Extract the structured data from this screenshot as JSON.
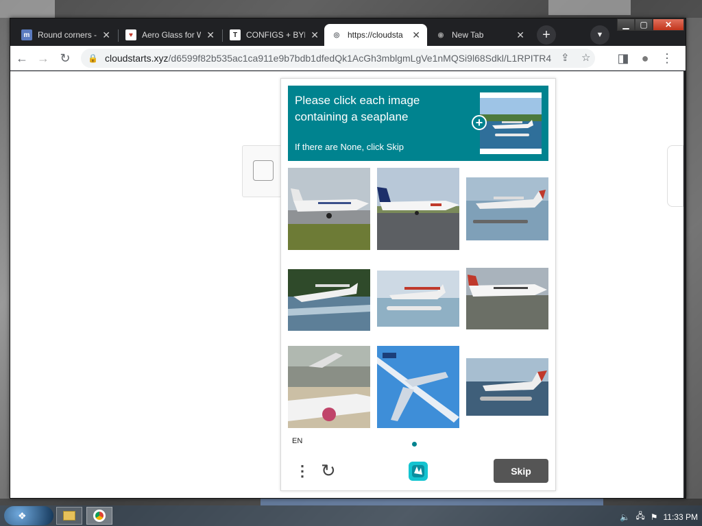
{
  "tabs": [
    {
      "title": "Round corners - ",
      "favicon_text": "m",
      "favicon_color": "#5b7bbf",
      "active": false
    },
    {
      "title": "Aero Glass for W",
      "favicon_text": "♥",
      "favicon_color": "#c0392b",
      "active": false
    },
    {
      "title": "CONFIGS + BYPA",
      "favicon_text": "T",
      "favicon_color": "#222222",
      "active": false
    },
    {
      "title": "https://cloudsta",
      "favicon_text": "◎",
      "favicon_color": "#5f6368",
      "active": true
    },
    {
      "title": "New Tab",
      "favicon_text": "◉",
      "favicon_color": "#777777",
      "active": false
    }
  ],
  "tab_close_glyph": "✕",
  "new_tab_glyph": "+",
  "tab_search_glyph": "▼",
  "window_controls": {
    "minimize": "▁",
    "maximize": "▢",
    "close": "✕"
  },
  "address_bar": {
    "host": "cloudstarts.xyz",
    "path": "/d6599f82b535ac1ca911e9b7bdb1dfedQk1AcGh3mblgmLgVe1nMQSi9l68Sdkl/L1RPITR4"
  },
  "toolbar_icons": {
    "back": "←",
    "forward": "→",
    "reload": "↻",
    "share": "⇪",
    "star": "☆",
    "sidepanel": "◨",
    "profile": "●",
    "menu": "⋮",
    "lock": "🔒"
  },
  "challenge": {
    "prompt_line1": "Please click each image",
    "prompt_line2": "containing a seaplane",
    "sub_prompt": "If there are None, click Skip",
    "example_plus": "+",
    "language": "EN",
    "menu_glyph": "⋮",
    "refresh_glyph": "↻",
    "skip_label": "Skip",
    "accent_color": "#00838f",
    "images": [
      {
        "subject": "jet-on-runway"
      },
      {
        "subject": "jet-taxiing"
      },
      {
        "subject": "seaplane-on-water"
      },
      {
        "subject": "seaplane-takeoff"
      },
      {
        "subject": "seaplane-floats"
      },
      {
        "subject": "plane-on-grass"
      },
      {
        "subject": "airliner-landing"
      },
      {
        "subject": "airliner-in-sky"
      },
      {
        "subject": "seaplane-on-water"
      }
    ]
  },
  "taskbar": {
    "start_glyph": "❖",
    "tray_time": "11:33 PM"
  }
}
